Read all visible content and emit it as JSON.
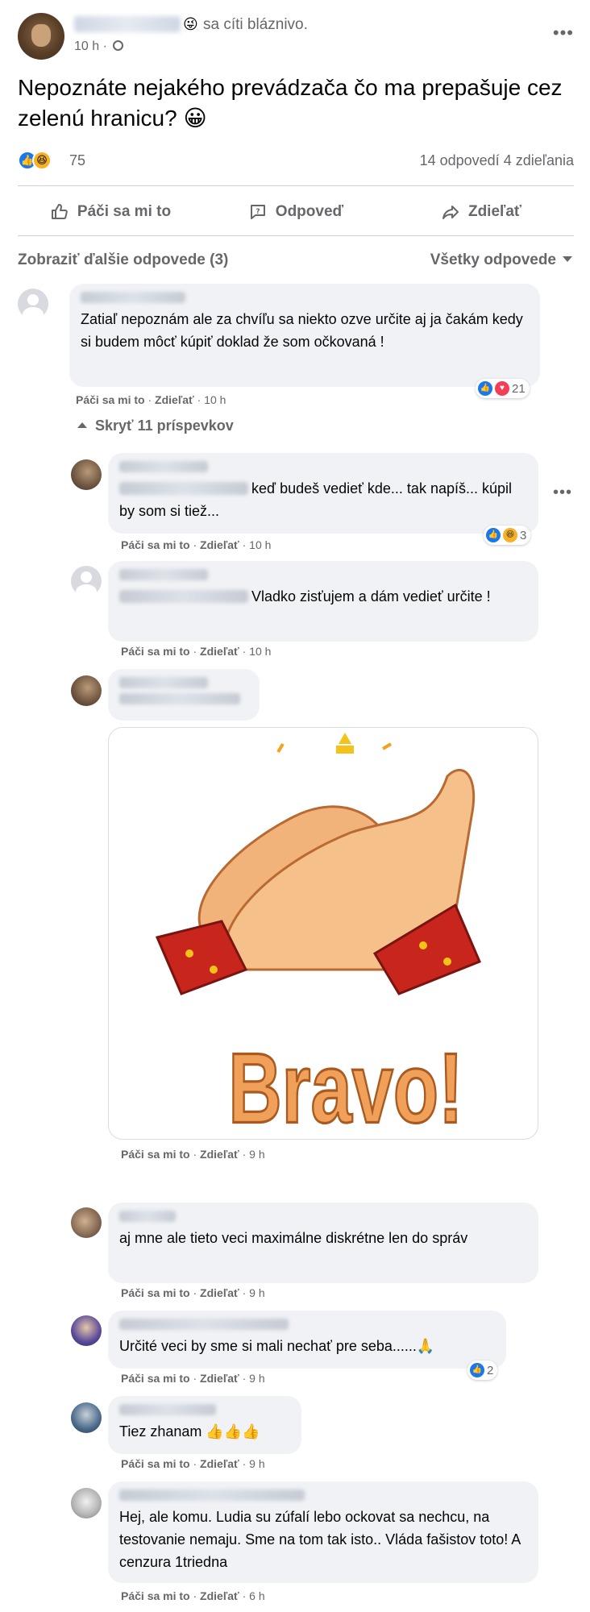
{
  "post": {
    "feeling": "sa cíti bláznivo.",
    "feeling_emoji": "😜",
    "time": "10 h ·",
    "text": "Nepoznáte nejakého prevádzača čo ma prepašuje cez zelenú hranicu? 😀",
    "reactions_count": "75",
    "comments_count": "14 odpovedí",
    "shares_count": "4 zdieľania",
    "more_icon": "more-horizontal-icon"
  },
  "actions": {
    "like": "Páči sa mi to",
    "comment": "Odpoveď",
    "share": "Zdieľať"
  },
  "comments_header": {
    "more_replies": "Zobraziť ďalšie odpovede (3)",
    "filter": "Všetky odpovede"
  },
  "comments": [
    {
      "text": "Zatiaľ nepoznám ale za chvíľu sa niekto ozve určite aj ja čakám kedy si budem môcť kúpiť doklad že som očkovaná !",
      "like": "Páči sa mi to",
      "share": "Zdieľať",
      "time": "10 h",
      "reactions": "21"
    },
    {
      "text": "keď budeš vedieť kde... tak napíš... kúpil by som si tiež...",
      "like": "Páči sa mi to",
      "share": "Zdieľať",
      "time": "10 h",
      "reactions": "3"
    },
    {
      "text": "Vladko zisťujem a dám vedieť určite !",
      "like": "Páči sa mi to",
      "share": "Zdieľať",
      "time": "10 h"
    },
    {
      "gif_text": "Bravo!",
      "like": "Páči sa mi to",
      "share": "Zdieľať",
      "time": "9 h"
    },
    {
      "text": "aj mne ale tieto veci maximálne diskrétne len do správ",
      "like": "Páči sa mi to",
      "share": "Zdieľať",
      "time": "9 h"
    },
    {
      "text": "Určité veci by sme si mali nechať pre seba......🙏",
      "like": "Páči sa mi to",
      "share": "Zdieľať",
      "time": "9 h",
      "reactions": "2"
    },
    {
      "text": "Tiez zhanam 👍👍👍",
      "like": "Páči sa mi to",
      "share": "Zdieľať",
      "time": "9 h"
    },
    {
      "text": "Hej, ale komu. Ludia su zúfalí lebo ockovat sa nechcu, na testovanie nemaju. Sme na tom tak isto.. Vláda fašistov toto! A cenzura 1triedna",
      "like": "Páči sa mi to",
      "share": "Zdieľať",
      "time": "6 h"
    }
  ],
  "hide_replies": "Skryť 11 príspevkov",
  "separator": "·"
}
